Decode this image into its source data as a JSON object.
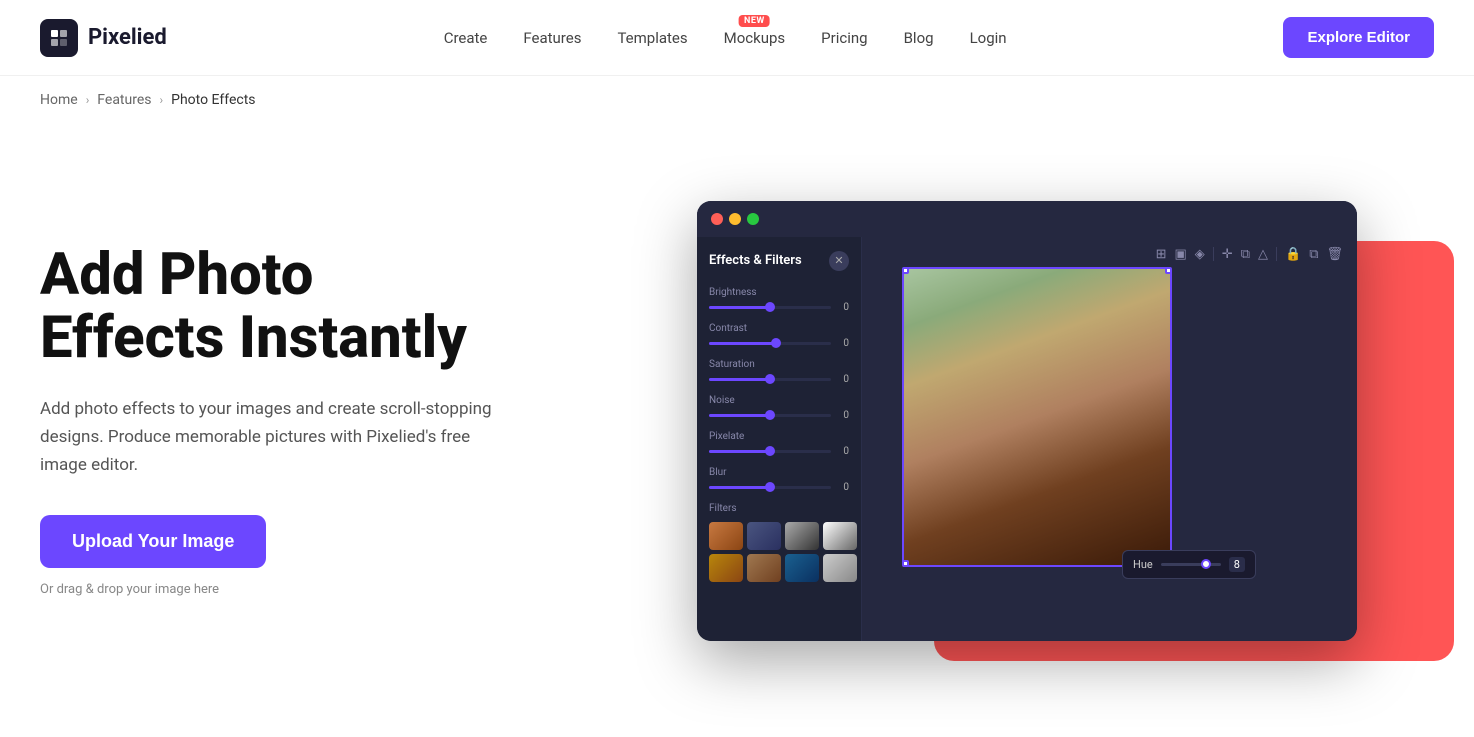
{
  "nav": {
    "logo_text": "Pixelied",
    "links": [
      {
        "label": "Create",
        "id": "create",
        "badge": null
      },
      {
        "label": "Features",
        "id": "features",
        "badge": null
      },
      {
        "label": "Templates",
        "id": "templates",
        "badge": null
      },
      {
        "label": "Mockups",
        "id": "mockups",
        "badge": "NEW"
      },
      {
        "label": "Pricing",
        "id": "pricing",
        "badge": null
      },
      {
        "label": "Blog",
        "id": "blog",
        "badge": null
      },
      {
        "label": "Login",
        "id": "login",
        "badge": null
      }
    ],
    "cta_label": "Explore Editor"
  },
  "breadcrumb": {
    "home": "Home",
    "features": "Features",
    "current": "Photo Effects"
  },
  "hero": {
    "title_line1": "Add Photo",
    "title_line2": "Effects Instantly",
    "description": "Add photo effects to your images and create scroll-stopping designs. Produce memorable pictures with Pixelied's free image editor.",
    "upload_btn": "Upload Your Image",
    "drag_drop": "Or drag & drop your image here"
  },
  "editor": {
    "panel_title": "Effects & Filters",
    "sliders": [
      {
        "label": "Brightness",
        "value": "0",
        "fill_pct": 50
      },
      {
        "label": "Contrast",
        "value": "0",
        "fill_pct": 55
      },
      {
        "label": "Saturation",
        "value": "0",
        "fill_pct": 50
      },
      {
        "label": "Noise",
        "value": "0",
        "fill_pct": 50
      },
      {
        "label": "Pixelate",
        "value": "0",
        "fill_pct": 50
      },
      {
        "label": "Blur",
        "value": "0",
        "fill_pct": 50
      }
    ],
    "filters_label": "Filters",
    "hue_label": "Hue",
    "hue_value": "8"
  },
  "colors": {
    "accent": "#6c47ff",
    "danger": "#ff5555"
  }
}
